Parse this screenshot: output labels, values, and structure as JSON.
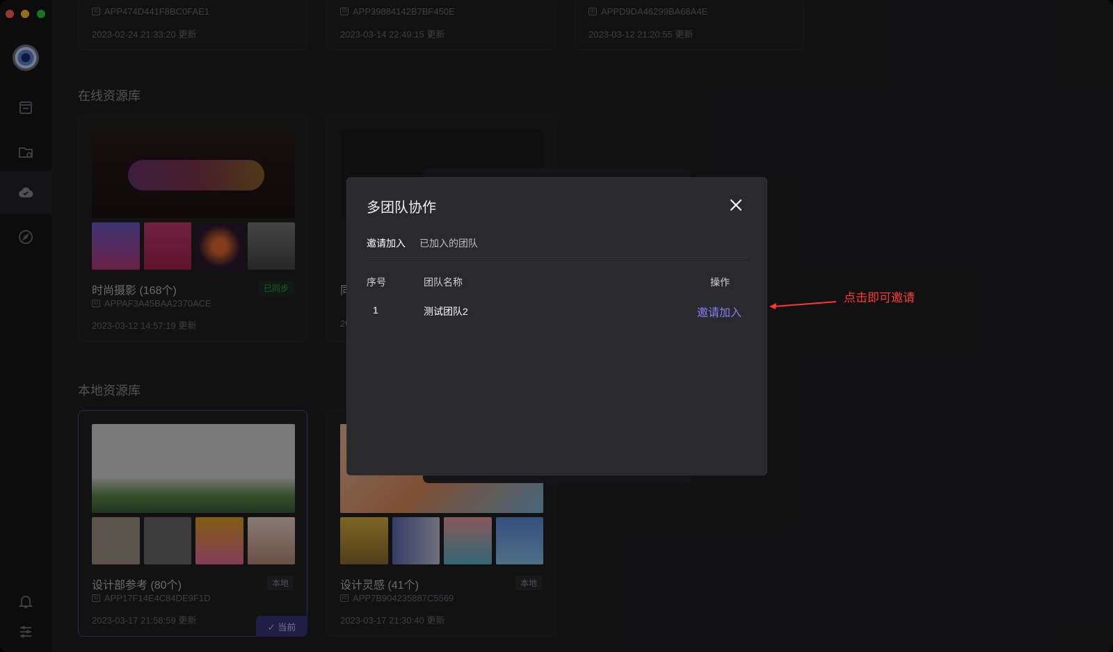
{
  "sidebar": {
    "icons": [
      "avatar",
      "store-icon",
      "folder-sync-icon",
      "cloud-check-icon",
      "compass-icon",
      "bell-icon",
      "settings-sliders-icon"
    ]
  },
  "top_cards": [
    {
      "code": "APP474D441F8BC0FAE1",
      "time": "2023-02-24 21:33:20 更新"
    },
    {
      "code": "APP39884142B7BF450E",
      "time": "2023-03-14 22:49:15 更新"
    },
    {
      "code": "APPD9DA46299BA68A4E",
      "time": "2023-03-12 21:20:55 更新"
    }
  ],
  "online": {
    "title": "在线资源库",
    "cards": [
      {
        "name": "时尚摄影 (168个)",
        "code": "APPAF3A45BAA2370ACE",
        "time": "2023-03-12 14:57:19 更新",
        "tag": "已同步"
      },
      {
        "name": "同",
        "code": "",
        "time": "20"
      }
    ]
  },
  "local": {
    "title": "本地资源库",
    "cards": [
      {
        "name": "设计部参考 (80个)",
        "code": "APP17F14E4C84DE9F1D",
        "time": "2023-03-17 21:58:59 更新",
        "tag": "本地",
        "current": "✓ 当前"
      },
      {
        "name": "设计灵感 (41个)",
        "code": "APP7B904235887C5569",
        "time": "2023-03-17 21:30:40 更新",
        "tag": "本地"
      }
    ]
  },
  "modal": {
    "title": "多团队协作",
    "tabs": [
      "邀请加入",
      "已加入的团队"
    ],
    "columns": [
      "序号",
      "团队名称",
      "操作"
    ],
    "rows": [
      {
        "index": "1",
        "team": "测试团队2",
        "action": "邀请加入"
      }
    ]
  },
  "annotation": "点击即可邀请",
  "colors": {
    "accent": "#8b7cf6",
    "annotation": "#ff3b2f"
  }
}
